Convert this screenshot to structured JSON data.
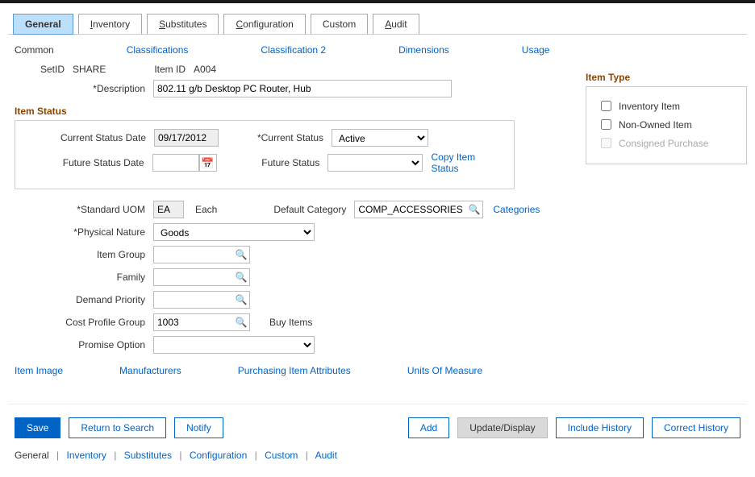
{
  "tabs": {
    "general": "General",
    "inventory": "Inventory",
    "substitutes": "Substitutes",
    "configuration": "Configuration",
    "custom": "Custom",
    "audit": "Audit"
  },
  "sublinks": {
    "common": "Common",
    "classifications": "Classifications",
    "classification2": "Classification 2",
    "dimensions": "Dimensions",
    "usage": "Usage"
  },
  "header": {
    "setid_label": "SetID",
    "setid_value": "SHARE",
    "itemid_label": "Item ID",
    "itemid_value": "A004",
    "description_label": "Description",
    "description_value": "802.11 g/b Desktop PC Router, Hub"
  },
  "item_type": {
    "title": "Item Type",
    "inventory": "Inventory Item",
    "nonowned": "Non-Owned Item",
    "consigned": "Consigned Purchase"
  },
  "status": {
    "title": "Item Status",
    "current_date_label": "Current Status Date",
    "current_date_value": "09/17/2012",
    "current_status_label": "Current Status",
    "current_status_value": "Active",
    "future_date_label": "Future Status Date",
    "future_date_value": "",
    "future_status_label": "Future Status",
    "future_status_value": "",
    "copy_link": "Copy Item Status"
  },
  "fields": {
    "std_uom_label": "Standard UOM",
    "std_uom_value": "EA",
    "std_uom_desc": "Each",
    "default_cat_label": "Default Category",
    "default_cat_value": "COMP_ACCESSORIES",
    "categories_link": "Categories",
    "physical_nature_label": "Physical Nature",
    "physical_nature_value": "Goods",
    "item_group_label": "Item Group",
    "item_group_value": "",
    "family_label": "Family",
    "family_value": "",
    "demand_priority_label": "Demand Priority",
    "demand_priority_value": "",
    "cost_profile_label": "Cost Profile Group",
    "cost_profile_value": "1003",
    "cost_profile_desc": "Buy Items",
    "promise_option_label": "Promise Option",
    "promise_option_value": ""
  },
  "bottom_links": {
    "item_image": "Item Image",
    "manufacturers": "Manufacturers",
    "purchasing_attrs": "Purchasing Item Attributes",
    "uom": "Units Of Measure"
  },
  "actions": {
    "save": "Save",
    "return": "Return to Search",
    "notify": "Notify",
    "add": "Add",
    "update_display": "Update/Display",
    "include_history": "Include History",
    "correct_history": "Correct History"
  },
  "breadcrumb": {
    "general": "General",
    "inventory": "Inventory",
    "substitutes": "Substitutes",
    "configuration": "Configuration",
    "custom": "Custom",
    "audit": "Audit"
  }
}
